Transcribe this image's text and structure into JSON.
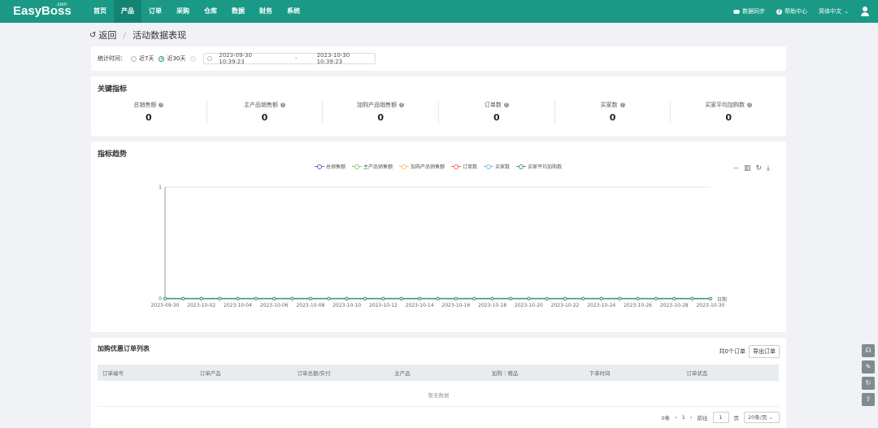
{
  "header": {
    "logo": "EasyBoss",
    "logo_sup": ".com",
    "nav": [
      "首页",
      "产品",
      "订单",
      "采购",
      "仓库",
      "数据",
      "财务",
      "系统"
    ],
    "active_nav": "产品",
    "sync": "数据同步",
    "help": "帮助中心",
    "language": "简体中文"
  },
  "breadcrumb": {
    "back": "返回",
    "current": "活动数据表现"
  },
  "filter": {
    "label": "统计时间：",
    "options": [
      "近7天",
      "近30天"
    ],
    "selected": "近30天",
    "date_start": "2023-09-30 10:39:23",
    "date_sep": "-",
    "date_end": "2023-10-30 10:39:23"
  },
  "kpi": {
    "title": "关键指标",
    "items": [
      {
        "label": "总销售额",
        "value": "0"
      },
      {
        "label": "主产品销售额",
        "value": "0"
      },
      {
        "label": "加购产品销售额",
        "value": "0"
      },
      {
        "label": "订单数",
        "value": "0"
      },
      {
        "label": "买家数",
        "value": "0"
      },
      {
        "label": "买家平均加购数",
        "value": "0"
      }
    ]
  },
  "trend": {
    "title": "指标趋势"
  },
  "chart_data": {
    "type": "line",
    "title": "",
    "xlabel": "日期",
    "ylabel": "",
    "ylim": [
      0,
      1
    ],
    "yticks": [
      "0",
      "1"
    ],
    "legend_position": "top-center",
    "categories": [
      "2023-09-30",
      "2023-10-01",
      "2023-10-02",
      "2023-10-03",
      "2023-10-04",
      "2023-10-05",
      "2023-10-06",
      "2023-10-07",
      "2023-10-08",
      "2023-10-09",
      "2023-10-10",
      "2023-10-11",
      "2023-10-12",
      "2023-10-13",
      "2023-10-14",
      "2023-10-15",
      "2023-10-16",
      "2023-10-17",
      "2023-10-18",
      "2023-10-19",
      "2023-10-20",
      "2023-10-21",
      "2023-10-22",
      "2023-10-23",
      "2023-10-24",
      "2023-10-25",
      "2023-10-26",
      "2023-10-27",
      "2023-10-28",
      "2023-10-29",
      "2023-10-30"
    ],
    "tick_labels": [
      "2023-09-30",
      "2023-10-02",
      "2023-10-04",
      "2023-10-06",
      "2023-10-08",
      "2023-10-10",
      "2023-10-12",
      "2023-10-14",
      "2023-10-16",
      "2023-10-18",
      "2023-10-20",
      "2023-10-22",
      "2023-10-24",
      "2023-10-26",
      "2023-10-28",
      "2023-10-30"
    ],
    "series": [
      {
        "name": "总销售额",
        "color": "#5470c6",
        "values": [
          0,
          0,
          0,
          0,
          0,
          0,
          0,
          0,
          0,
          0,
          0,
          0,
          0,
          0,
          0,
          0,
          0,
          0,
          0,
          0,
          0,
          0,
          0,
          0,
          0,
          0,
          0,
          0,
          0,
          0,
          0
        ]
      },
      {
        "name": "主产品销售额",
        "color": "#91cc75",
        "values": [
          0,
          0,
          0,
          0,
          0,
          0,
          0,
          0,
          0,
          0,
          0,
          0,
          0,
          0,
          0,
          0,
          0,
          0,
          0,
          0,
          0,
          0,
          0,
          0,
          0,
          0,
          0,
          0,
          0,
          0,
          0
        ]
      },
      {
        "name": "加购产品销售额",
        "color": "#fac858",
        "values": [
          0,
          0,
          0,
          0,
          0,
          0,
          0,
          0,
          0,
          0,
          0,
          0,
          0,
          0,
          0,
          0,
          0,
          0,
          0,
          0,
          0,
          0,
          0,
          0,
          0,
          0,
          0,
          0,
          0,
          0,
          0
        ]
      },
      {
        "name": "订单数",
        "color": "#ee6666",
        "values": [
          0,
          0,
          0,
          0,
          0,
          0,
          0,
          0,
          0,
          0,
          0,
          0,
          0,
          0,
          0,
          0,
          0,
          0,
          0,
          0,
          0,
          0,
          0,
          0,
          0,
          0,
          0,
          0,
          0,
          0,
          0
        ]
      },
      {
        "name": "买家数",
        "color": "#73c0de",
        "values": [
          0,
          0,
          0,
          0,
          0,
          0,
          0,
          0,
          0,
          0,
          0,
          0,
          0,
          0,
          0,
          0,
          0,
          0,
          0,
          0,
          0,
          0,
          0,
          0,
          0,
          0,
          0,
          0,
          0,
          0,
          0
        ]
      },
      {
        "name": "买家平均加购数",
        "color": "#3ba272",
        "values": [
          0,
          0,
          0,
          0,
          0,
          0,
          0,
          0,
          0,
          0,
          0,
          0,
          0,
          0,
          0,
          0,
          0,
          0,
          0,
          0,
          0,
          0,
          0,
          0,
          0,
          0,
          0,
          0,
          0,
          0,
          0
        ]
      }
    ]
  },
  "orders": {
    "title": "加购优惠订单列表",
    "count_text": "共0个订单",
    "export": "导出订单",
    "columns": [
      "订单编号",
      "订单产品",
      "订单总额/实付",
      "主产品",
      "加购｜赠品",
      "下单时间",
      "订单状态"
    ],
    "empty": "暂无数据",
    "pager": {
      "total": "0条",
      "page": "1",
      "goto": "前往",
      "goto_value": "1",
      "page_unit": "页",
      "size": "20条/页"
    }
  }
}
